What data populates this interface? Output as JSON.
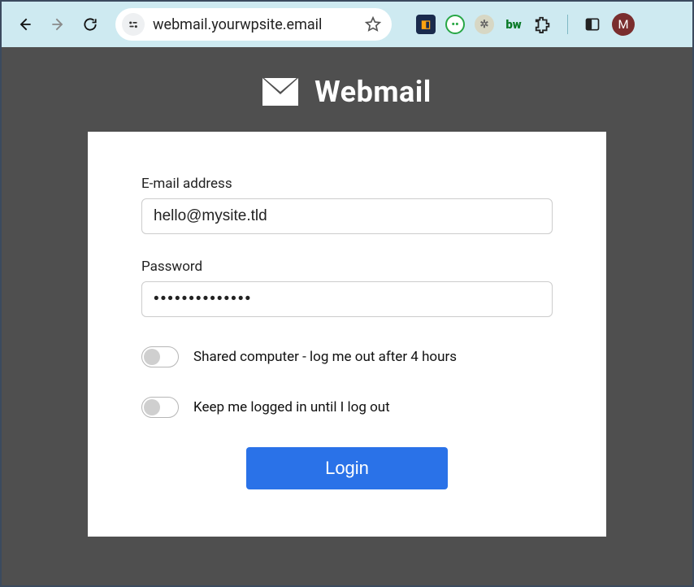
{
  "browser": {
    "url": "webmail.yourwpsite.email",
    "avatar_initial": "M"
  },
  "header": {
    "title": "Webmail"
  },
  "form": {
    "email_label": "E-mail address",
    "email_value": "hello@mysite.tld",
    "password_label": "Password",
    "password_value": "••••••••••••••",
    "toggle_shared_label": "Shared computer - log me out after 4 hours",
    "toggle_keep_label": "Keep me logged in until I log out",
    "login_label": "Login"
  }
}
